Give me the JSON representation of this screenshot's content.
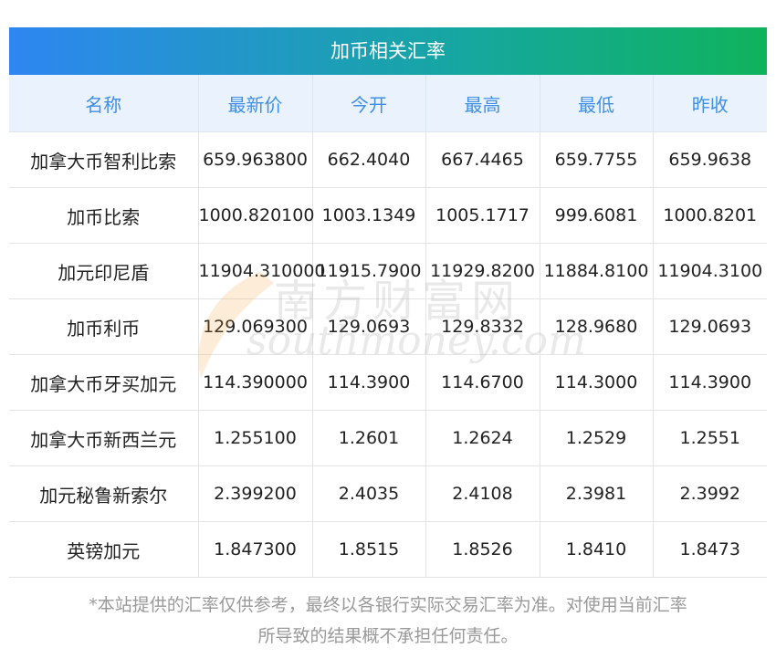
{
  "title": "加币相关汇率",
  "headers": [
    "名称",
    "最新价",
    "今开",
    "最高",
    "最低",
    "昨收"
  ],
  "rows": [
    [
      "加拿大币智利比索",
      "659.963800",
      "662.4040",
      "667.4465",
      "659.7755",
      "659.9638"
    ],
    [
      "加币比索",
      "1000.820100",
      "1003.1349",
      "1005.1717",
      "999.6081",
      "1000.8201"
    ],
    [
      "加元印尼盾",
      "11904.310000",
      "11915.7900",
      "11929.8200",
      "11884.8100",
      "11904.3100"
    ],
    [
      "加币利币",
      "129.069300",
      "129.0693",
      "129.8332",
      "128.9680",
      "129.0693"
    ],
    [
      "加拿大币牙买加元",
      "114.390000",
      "114.3900",
      "114.6700",
      "114.3000",
      "114.3900"
    ],
    [
      "加拿大币新西兰元",
      "1.255100",
      "1.2601",
      "1.2624",
      "1.2529",
      "1.2551"
    ],
    [
      "加元秘鲁新索尔",
      "2.399200",
      "2.4035",
      "2.4108",
      "2.3981",
      "2.3992"
    ],
    [
      "英镑加元",
      "1.847300",
      "1.8515",
      "1.8526",
      "1.8410",
      "1.8473"
    ]
  ],
  "note_line1": "*本站提供的汇率仅供参考，最终以各银行实际交易汇率为准。对使用当前汇率",
  "note_line2": "所导致的结果概不承担任何责任。",
  "watermark_cn": "南方财富网",
  "watermark_en": "southmoney.com",
  "colors": {
    "header_text": "#3f8fe6",
    "header_bg": "#eaf3fd",
    "title_gradient_start": "#2e86f2",
    "title_gradient_end": "#0fb35c"
  }
}
